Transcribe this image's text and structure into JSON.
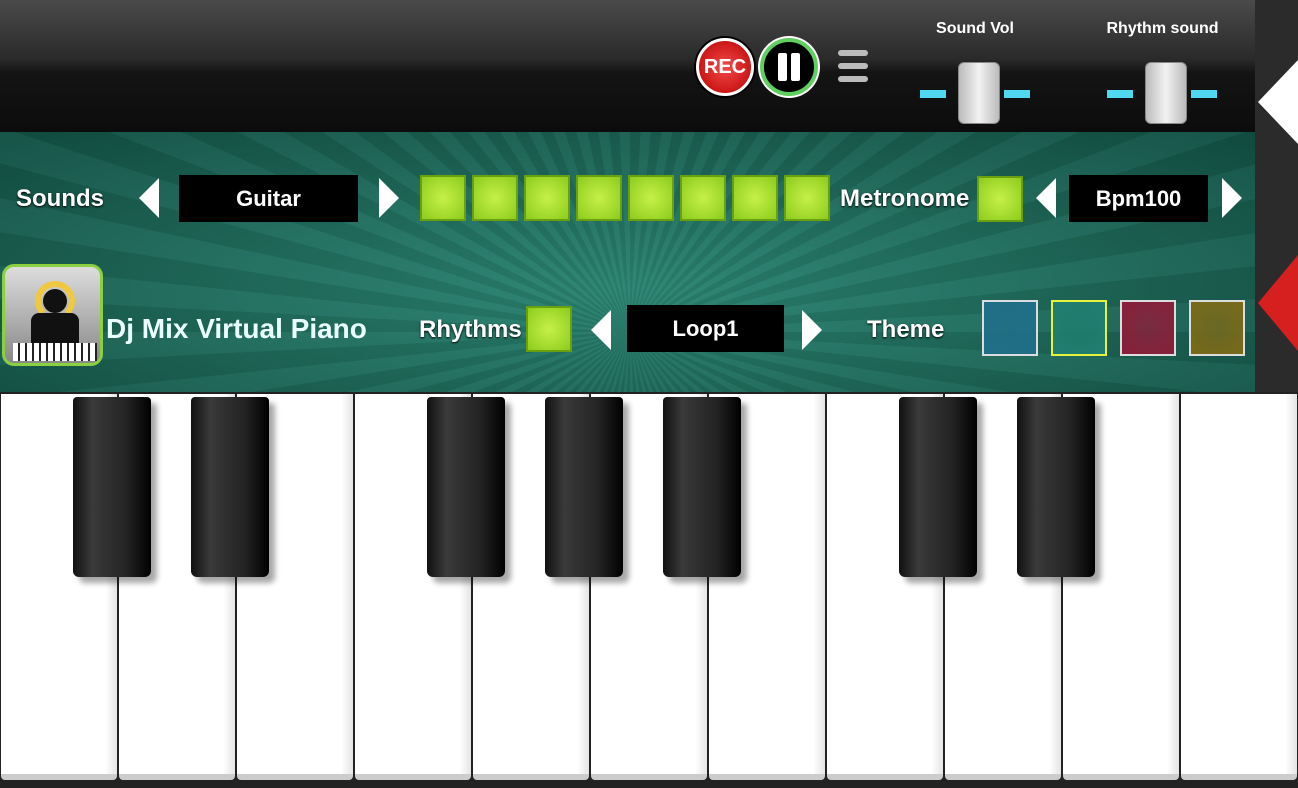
{
  "top": {
    "rec_label": "REC",
    "sound_vol_label": "Sound Vol",
    "rhythm_sound_label": "Rhythm sound",
    "sound_vol": 0.5,
    "rhythm_sound": 0.5
  },
  "sounds": {
    "label": "Sounds",
    "value": "Guitar"
  },
  "pads_count": 8,
  "metronome": {
    "label": "Metronome",
    "value": "Bpm100"
  },
  "app": {
    "title": "Dj Mix Virtual Piano"
  },
  "rhythms": {
    "label": "Rhythms",
    "value": "Loop1"
  },
  "theme": {
    "label": "Theme",
    "colors": [
      "#1f6f8a",
      "#1f7f70",
      "#8a1f3a",
      "#7a6a1a"
    ],
    "selected": 1
  },
  "colors": {
    "accent_led": "#a6e030",
    "slider_track": "#4fd8f0",
    "rec": "#d61f1f"
  }
}
